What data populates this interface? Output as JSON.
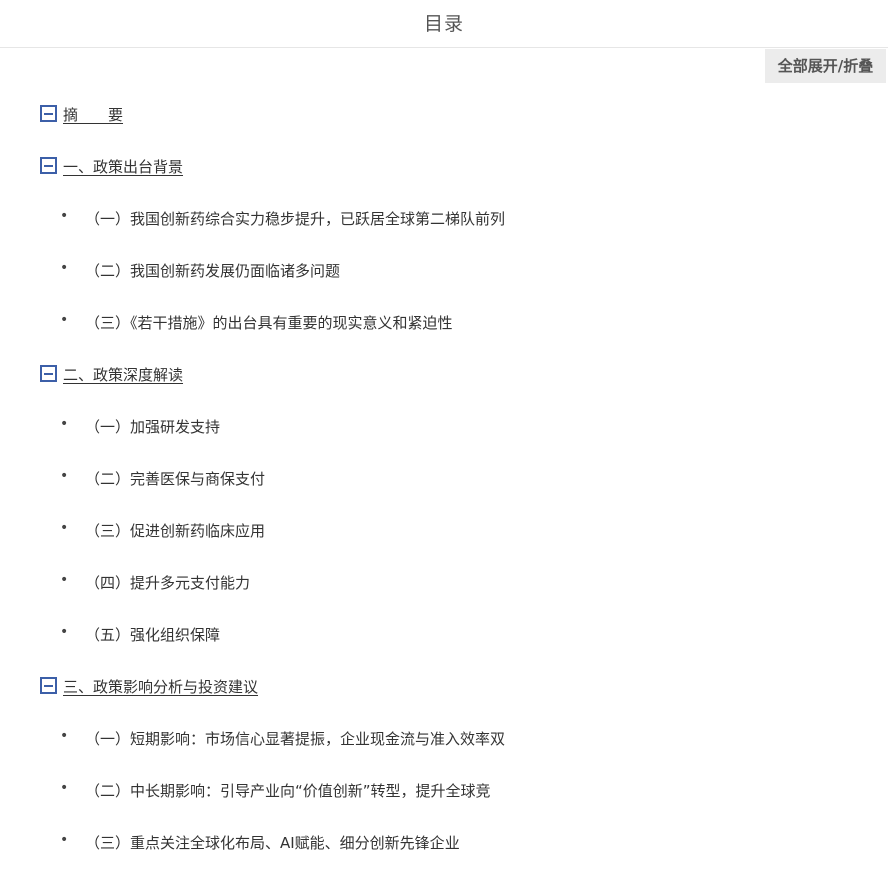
{
  "header": {
    "title": "目录"
  },
  "toolbar": {
    "toggle_all_label": "全部展开/折叠"
  },
  "colors": {
    "accent": "#3c5fa8",
    "text": "#333333",
    "toggle_bg": "#ececec"
  },
  "icons": {
    "section_toggle": "minus-square-icon",
    "bullet": "bullet-icon"
  },
  "bullet_glyph": "•",
  "toc": {
    "sections": [
      {
        "label": "摘　　要",
        "items": []
      },
      {
        "label": "一、政策出台背景",
        "items": [
          "（一）我国创新药综合实力稳步提升，已跃居全球第二梯队前列",
          "（二）我国创新药发展仍面临诸多问题",
          "（三）《若干措施》的出台具有重要的现实意义和紧迫性"
        ]
      },
      {
        "label": "二、政策深度解读",
        "items": [
          "（一）加强研发支持",
          "（二）完善医保与商保支付",
          "（三）促进创新药临床应用",
          "（四）提升多元支付能力",
          "（五）强化组织保障"
        ]
      },
      {
        "label": "三、政策影响分析与投资建议",
        "items": [
          "（一）短期影响：市场信心显著提振，企业现金流与准入效率双",
          "（二）中长期影响：引导产业向“价值创新”转型，提升全球竞",
          "（三）重点关注全球化布局、AI赋能、细分创新先锋企业"
        ]
      }
    ]
  }
}
